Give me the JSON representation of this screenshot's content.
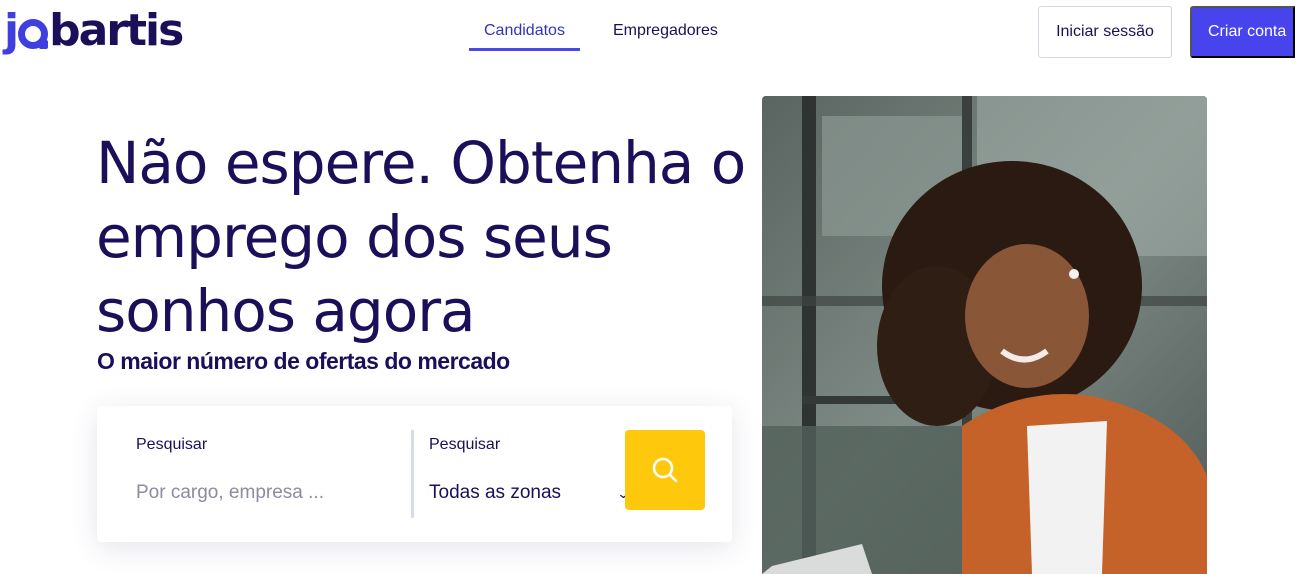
{
  "header": {
    "logo": {
      "j": "j",
      "rest": "bartis"
    },
    "nav": [
      {
        "label": "Candidatos",
        "active": true
      },
      {
        "label": "Empregadores",
        "active": false
      }
    ],
    "login_label": "Iniciar sessão",
    "signup_label": "Criar conta"
  },
  "hero": {
    "title": "Não espere. Obtenha o emprego dos seus sonhos agora",
    "subtitle": "O maior número de ofertas do mercado"
  },
  "search": {
    "keyword_label": "Pesquisar",
    "keyword_placeholder": "Por cargo, empresa ...",
    "keyword_value": "",
    "zone_label": "Pesquisar",
    "zone_selected": "Todas as zonas",
    "button_icon": "search-icon"
  },
  "image": {
    "icon": "photo-woman-laptop"
  },
  "colors": {
    "brand": "#4744ee",
    "text": "#1c0f5a",
    "search_button": "#fec90d"
  }
}
